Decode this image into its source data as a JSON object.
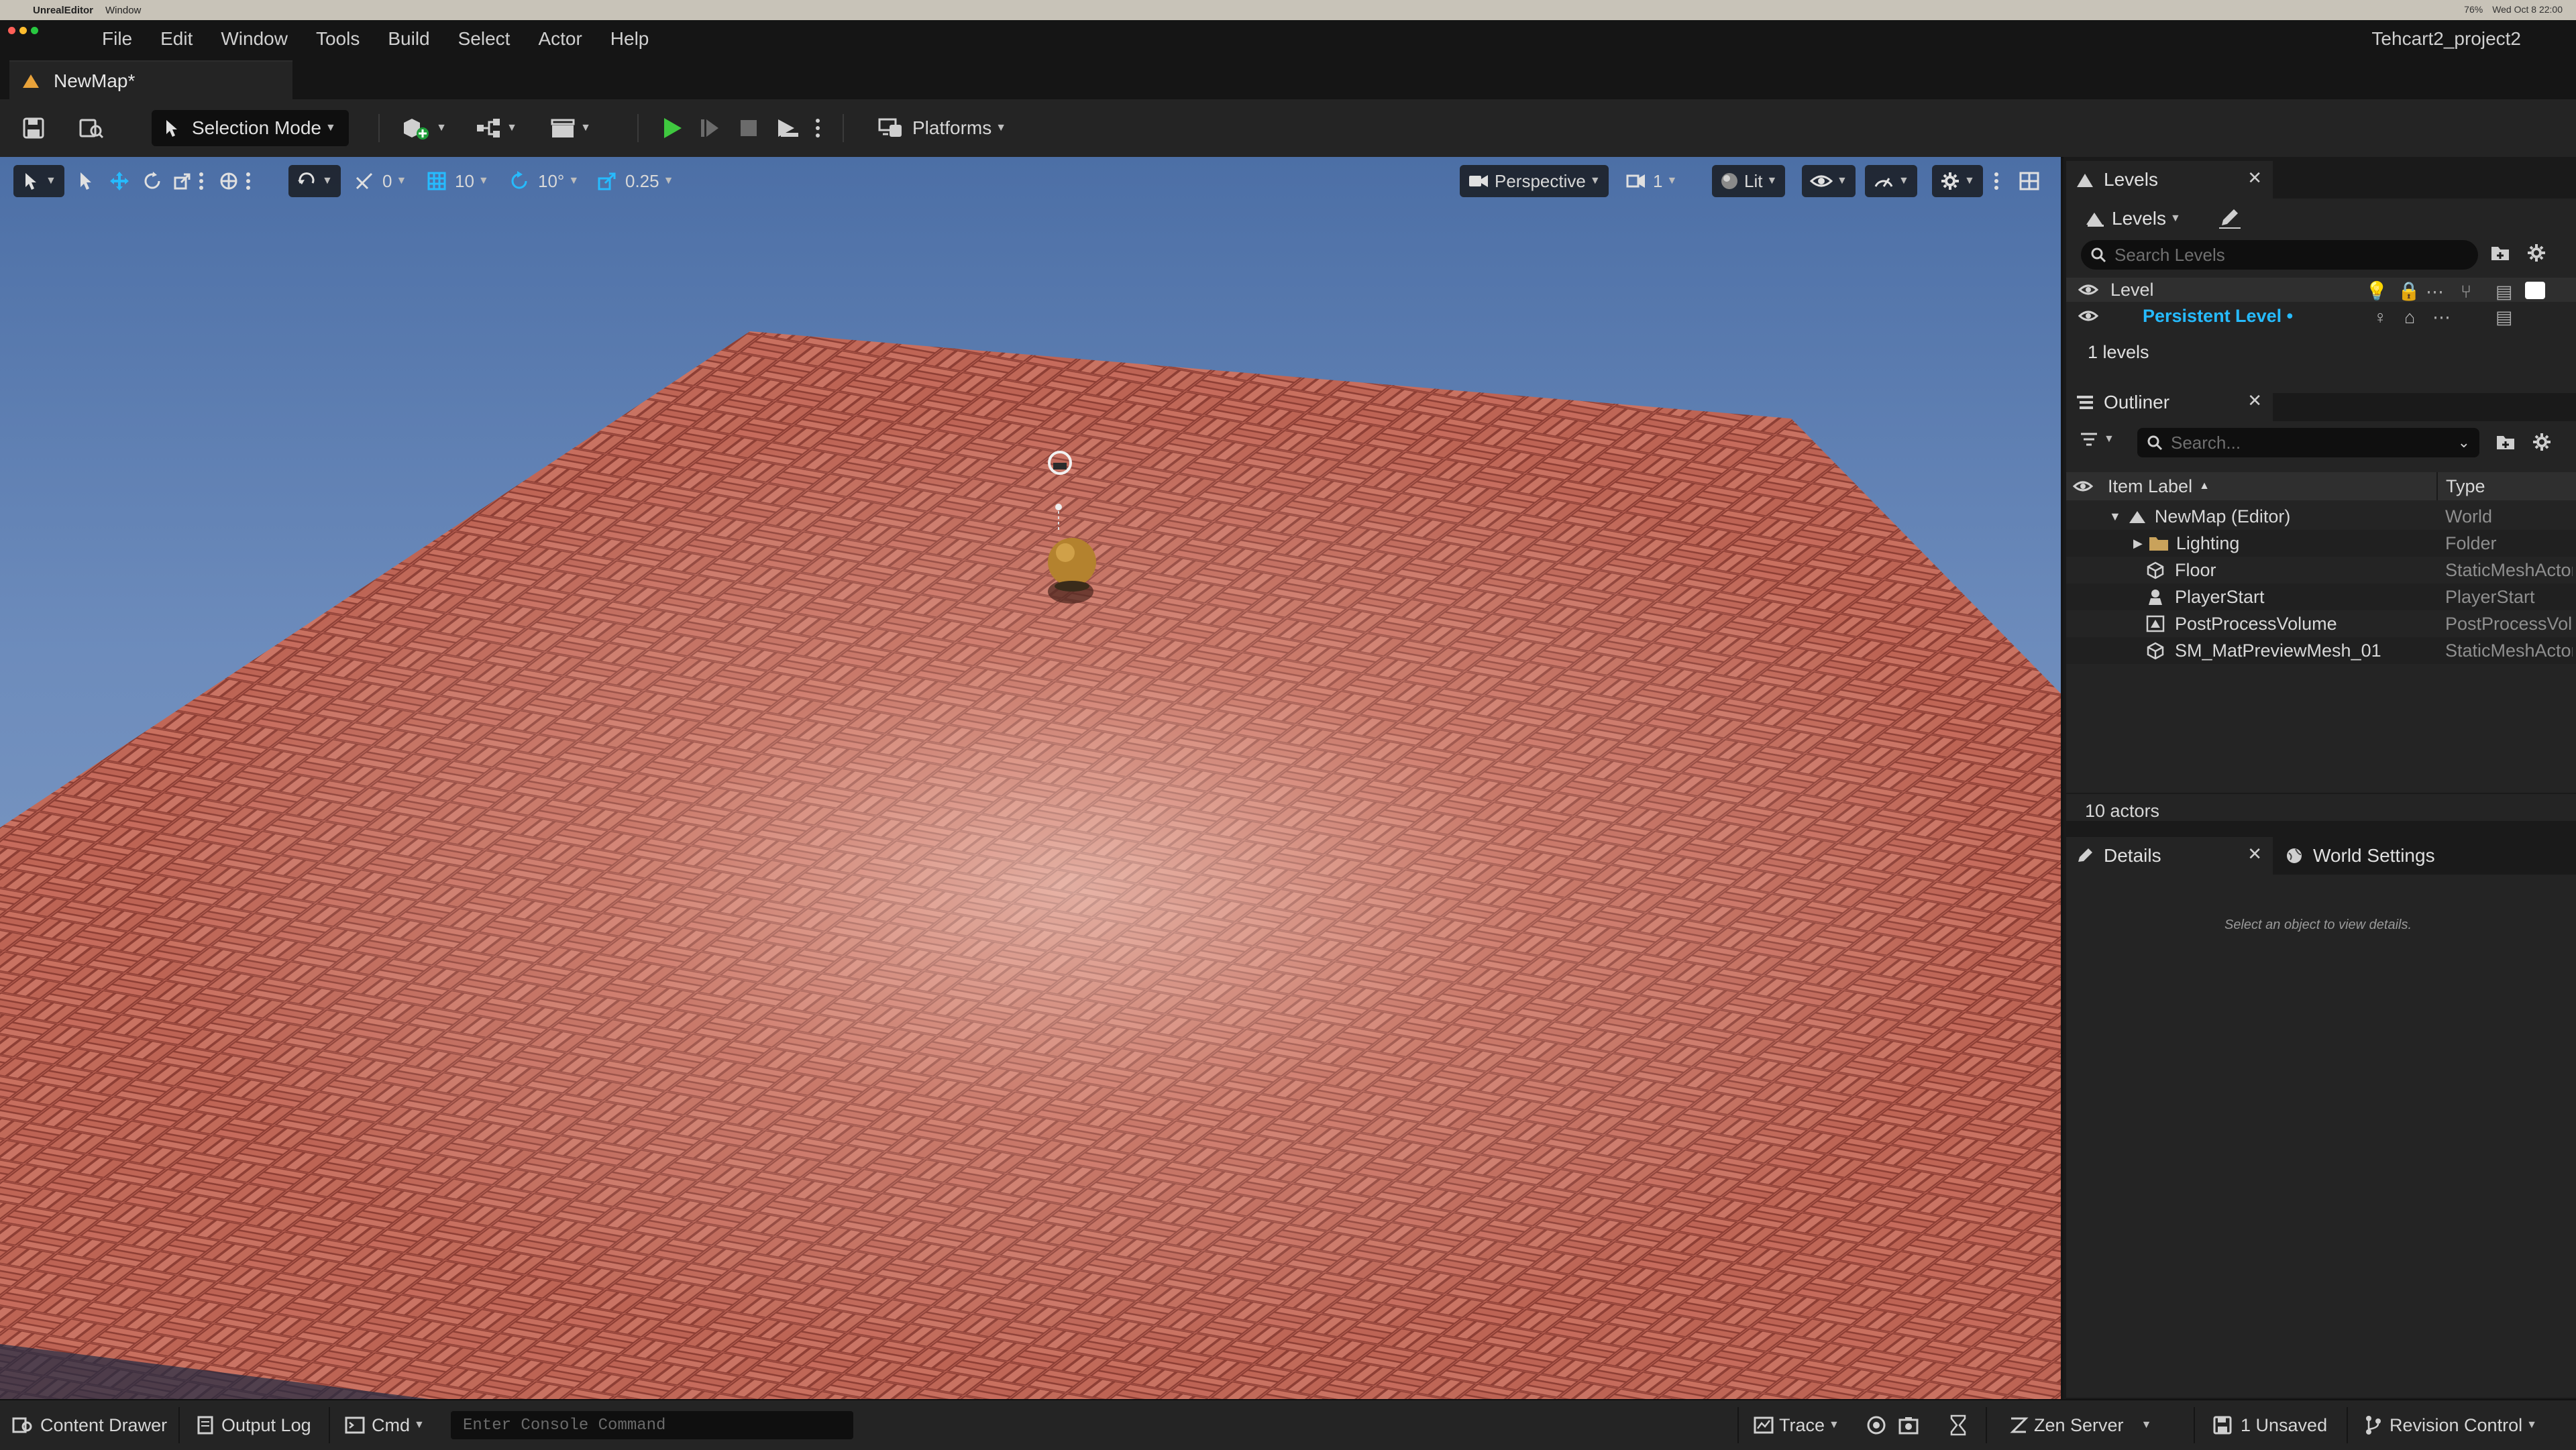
{
  "os_menubar": {
    "app_name": "UnrealEditor",
    "window_menu": "Window",
    "battery": "76%",
    "datetime": "Wed Oct 8  22:00"
  },
  "app_menu": {
    "items": [
      "File",
      "Edit",
      "Window",
      "Tools",
      "Build",
      "Select",
      "Actor",
      "Help"
    ],
    "project_name": "Tehcart2_project2"
  },
  "document_tab": {
    "label": "NewMap*"
  },
  "toolbar": {
    "selection_mode": "Selection Mode",
    "platforms": "Platforms"
  },
  "viewport_toolbar": {
    "snap_rotation_count": "0",
    "grid_snap": "10",
    "rotation_snap": "10°",
    "scale_snap": "0.25",
    "view_mode": "Perspective",
    "camera_speed": "1",
    "lighting_mode": "Lit"
  },
  "levels_panel": {
    "tab_title": "Levels",
    "dropdown_label": "Levels",
    "search_placeholder": "Search Levels",
    "header_label": "Level",
    "persistent_level": "Persistent Level •",
    "count_text": "1 levels"
  },
  "outliner_panel": {
    "tab_title": "Outliner",
    "search_placeholder": "Search...",
    "col_label": "Item Label",
    "col_type": "Type",
    "items": [
      {
        "label": "NewMap (Editor)",
        "type": "World"
      },
      {
        "label": "Lighting",
        "type": "Folder"
      },
      {
        "label": "Floor",
        "type": "StaticMeshActor"
      },
      {
        "label": "PlayerStart",
        "type": "PlayerStart"
      },
      {
        "label": "PostProcessVolume",
        "type": "PostProcessVolume"
      },
      {
        "label": "SM_MatPreviewMesh_01",
        "type": "StaticMeshActor"
      }
    ],
    "actor_count": "10 actors"
  },
  "details_panel": {
    "tab_title": "Details",
    "world_settings_tab": "World Settings",
    "empty_message": "Select an object to view details."
  },
  "statusbar": {
    "content_drawer": "Content Drawer",
    "output_log": "Output Log",
    "cmd": "Cmd",
    "console_placeholder": "Enter Console Command",
    "trace": "Trace",
    "zen_server": "Zen Server",
    "unsaved": "1 Unsaved",
    "revision_control": "Revision Control"
  },
  "colors": {
    "accent_blue": "#26bbff",
    "play_green": "#3fc83f",
    "sky_top": "#5878aa",
    "floor_brick": "#c0675a"
  }
}
